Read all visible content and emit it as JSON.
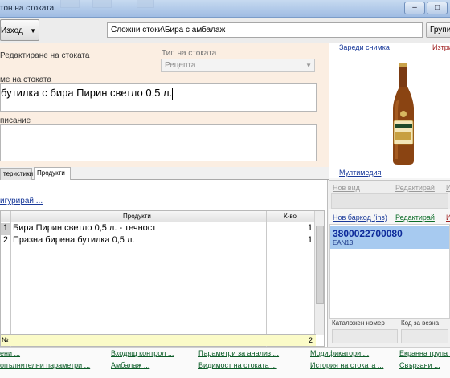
{
  "window": {
    "title": "тон на стоката"
  },
  "toolbar": {
    "exit_label": "Изход",
    "breadcrumb": "Сложни стоки\\Бира с амбалаж",
    "group_label": "Групи"
  },
  "form": {
    "mode_label": "Редактиране на стоката",
    "type_label": "Тип на стоката",
    "type_value": "Рецепта",
    "name_label": "ме на стоката",
    "name_value": "бутилка с бира Пирин светло 0,5 л.",
    "description_label": "писание"
  },
  "tabs": [
    {
      "label": "теристики"
    },
    {
      "label": "Продукти"
    }
  ],
  "products": {
    "configure_link": "игурирай ...",
    "columns": {
      "products": "Продукти",
      "qty": "К-во"
    },
    "rows": [
      {
        "num": "1",
        "name": "Бира Пирин светло 0,5 л. - течност",
        "qty": "1"
      },
      {
        "num": "2",
        "name": "Празна бирена бутилка 0,5 л.",
        "qty": "1"
      }
    ],
    "footer": {
      "num": "№",
      "total": "2"
    }
  },
  "right": {
    "load_photo": "Зареди снимка",
    "clear_photo": "Изтри",
    "multimedia": "Мултимедия",
    "new_variant": "Нов вид",
    "edit_variant": "Редактирай",
    "clear_variant": "И",
    "new_barcode": "Нов баркод (ins)",
    "edit_barcode": "Редактирай",
    "clear_barcode": "И",
    "barcode": {
      "code": "3800022700080",
      "type": "EAN13"
    },
    "catalog_label": "Каталожен номер",
    "scale_label": "Код за везна"
  },
  "bottom_links": [
    "ени ...",
    "Входящ контрол ...",
    "Параметри за анализ ...",
    "Модификатори ...",
    "Екранна група ...",
    "опълнителни параметри ...",
    "Амбалаж ...",
    "Видимост на стоката ...",
    "История на стоката ...",
    "Свързани ..."
  ],
  "colors": {
    "link_blue": "#1a3a9a",
    "link_green": "#0c5d28",
    "form_bg": "#fbeee2",
    "selection": "#a7caf0",
    "grid_footer": "#fbfbc8"
  }
}
